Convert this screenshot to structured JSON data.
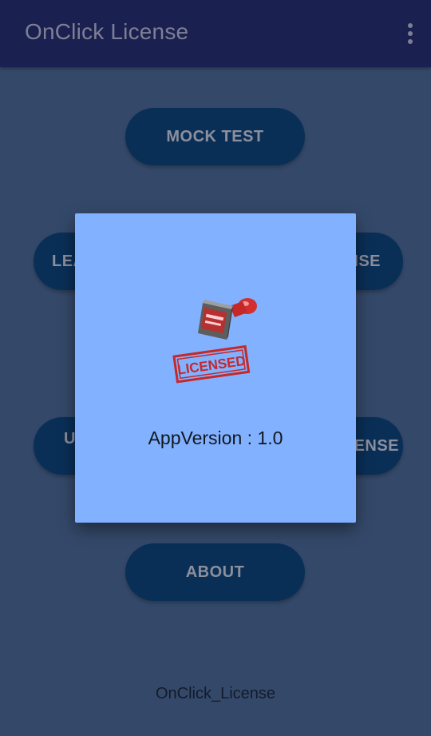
{
  "app_bar": {
    "title": "OnClick License",
    "overflow_icon": "more-vert-icon"
  },
  "menu": {
    "mock_test": "MOCK TEST",
    "left_row1_visible": "LEA",
    "right_row1_visible": "NSE",
    "left_row2_visible": "U",
    "right_row2_visible": "ENSE",
    "about": "ABOUT"
  },
  "footer": {
    "label": "OnClick_License"
  },
  "dialog": {
    "logo_icon": "licensed-stamp-icon",
    "logo_text": "LICENSED",
    "version_text": "AppVersion : 1.0"
  },
  "colors": {
    "app_bar": "#1a2150",
    "background": "#34496a",
    "button": "#0a2f57",
    "dialog": "#82b1ff",
    "stamp_red": "#c62828"
  }
}
